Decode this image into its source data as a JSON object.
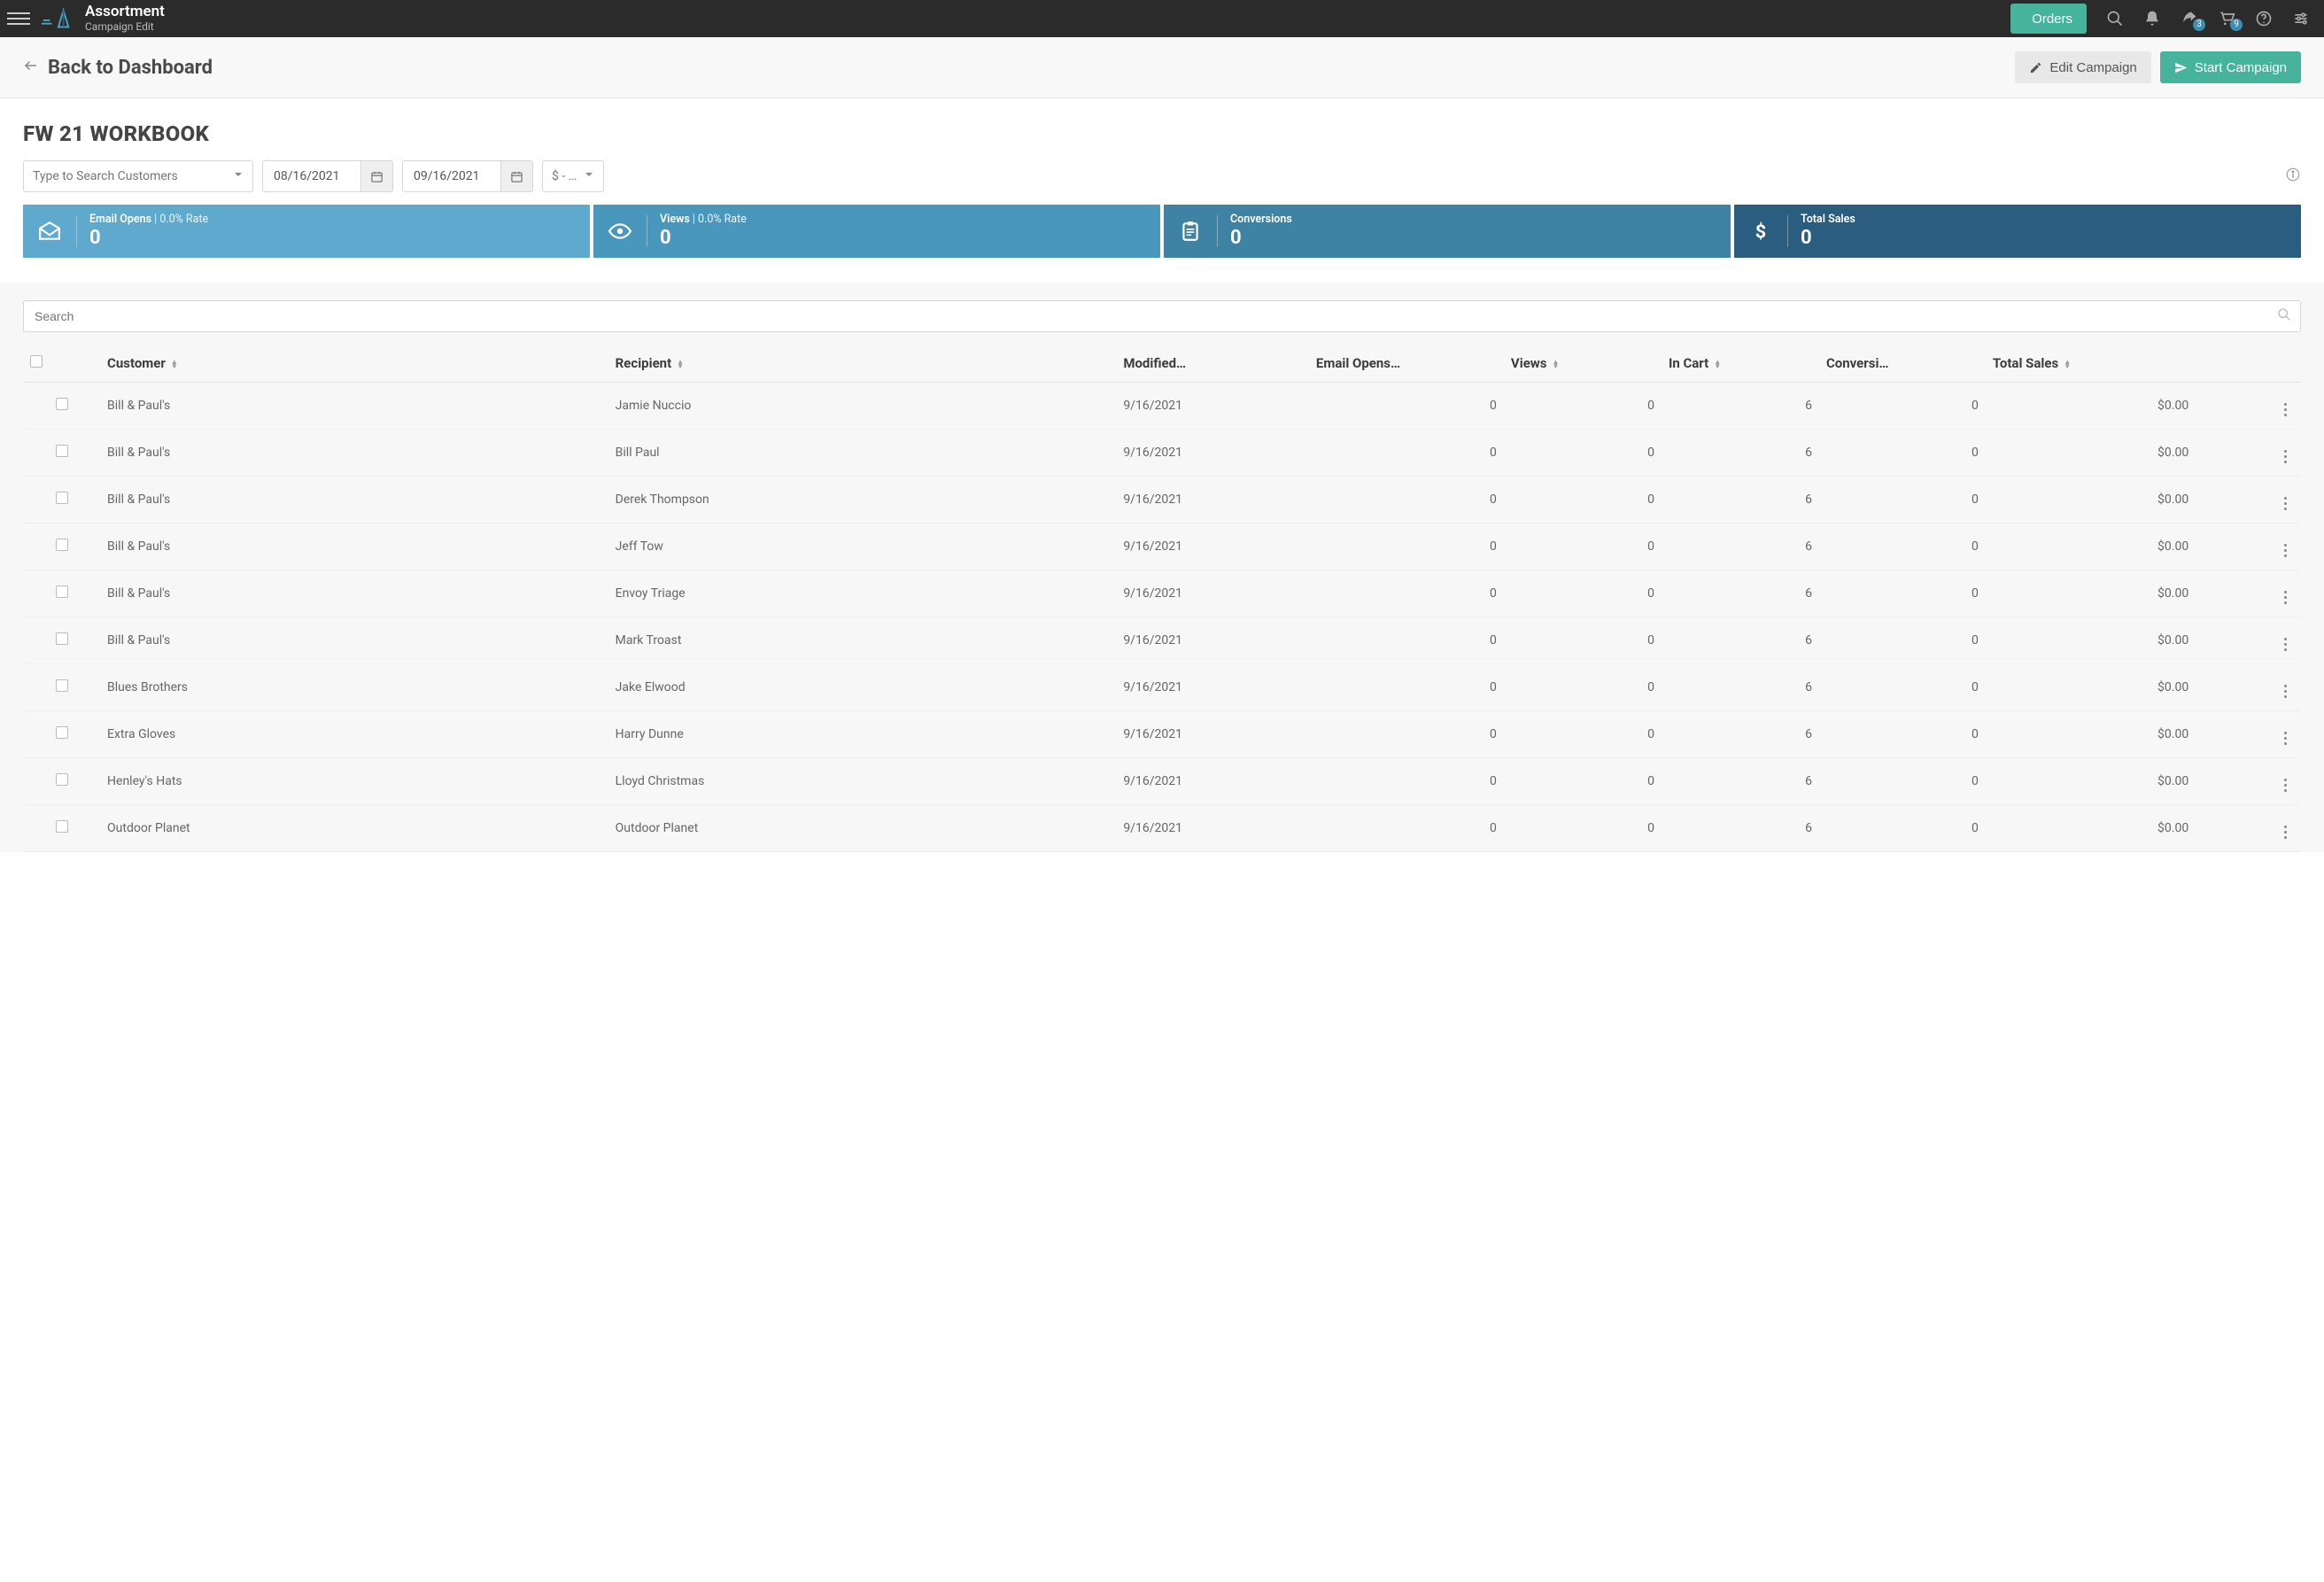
{
  "topbar": {
    "app_title": "Assortment",
    "app_subtitle": "Campaign Edit",
    "orders_label": "Orders",
    "share_badge": "3",
    "cart_badge": "9"
  },
  "subheader": {
    "back_label": "Back to Dashboard",
    "edit_label": "Edit Campaign",
    "start_label": "Start Campaign"
  },
  "page": {
    "title": "FW 21 WORKBOOK"
  },
  "filters": {
    "customer_placeholder": "Type to Search Customers",
    "date_start": "08/16/2021",
    "date_end": "09/16/2021",
    "currency_display": "$ - …"
  },
  "stats": {
    "email_opens": {
      "label": "Email Opens",
      "sub": " | 0.0% Rate",
      "value": "0"
    },
    "views": {
      "label": "Views",
      "sub": " | 0.0% Rate",
      "value": "0"
    },
    "conversions": {
      "label": "Conversions",
      "sub": "",
      "value": "0"
    },
    "total_sales": {
      "label": "Total Sales",
      "sub": "",
      "value": "0"
    }
  },
  "table": {
    "search_placeholder": "Search",
    "columns": {
      "customer": "Customer",
      "recipient": "Recipient",
      "modified": "Modified…",
      "email_opens": "Email Opens…",
      "views": "Views",
      "in_cart": "In Cart",
      "conversions": "Conversi…",
      "total_sales": "Total Sales"
    },
    "rows": [
      {
        "customer": "Bill & Paul's",
        "recipient": "Jamie Nuccio",
        "modified": "9/16/2021",
        "email_opens": "0",
        "views": "0",
        "in_cart": "6",
        "conversions": "0",
        "total_sales": "$0.00"
      },
      {
        "customer": "Bill & Paul's",
        "recipient": "Bill Paul",
        "modified": "9/16/2021",
        "email_opens": "0",
        "views": "0",
        "in_cart": "6",
        "conversions": "0",
        "total_sales": "$0.00"
      },
      {
        "customer": "Bill & Paul's",
        "recipient": "Derek Thompson",
        "modified": "9/16/2021",
        "email_opens": "0",
        "views": "0",
        "in_cart": "6",
        "conversions": "0",
        "total_sales": "$0.00"
      },
      {
        "customer": "Bill & Paul's",
        "recipient": "Jeff Tow",
        "modified": "9/16/2021",
        "email_opens": "0",
        "views": "0",
        "in_cart": "6",
        "conversions": "0",
        "total_sales": "$0.00"
      },
      {
        "customer": "Bill & Paul's",
        "recipient": "Envoy Triage",
        "modified": "9/16/2021",
        "email_opens": "0",
        "views": "0",
        "in_cart": "6",
        "conversions": "0",
        "total_sales": "$0.00"
      },
      {
        "customer": "Bill & Paul's",
        "recipient": "Mark Troast",
        "modified": "9/16/2021",
        "email_opens": "0",
        "views": "0",
        "in_cart": "6",
        "conversions": "0",
        "total_sales": "$0.00"
      },
      {
        "customer": "Blues Brothers",
        "recipient": "Jake Elwood",
        "modified": "9/16/2021",
        "email_opens": "0",
        "views": "0",
        "in_cart": "6",
        "conversions": "0",
        "total_sales": "$0.00"
      },
      {
        "customer": "Extra Gloves",
        "recipient": "Harry Dunne",
        "modified": "9/16/2021",
        "email_opens": "0",
        "views": "0",
        "in_cart": "6",
        "conversions": "0",
        "total_sales": "$0.00"
      },
      {
        "customer": "Henley's Hats",
        "recipient": "Lloyd Christmas",
        "modified": "9/16/2021",
        "email_opens": "0",
        "views": "0",
        "in_cart": "6",
        "conversions": "0",
        "total_sales": "$0.00"
      },
      {
        "customer": "Outdoor Planet",
        "recipient": "Outdoor Planet",
        "modified": "9/16/2021",
        "email_opens": "0",
        "views": "0",
        "in_cart": "6",
        "conversions": "0",
        "total_sales": "$0.00"
      }
    ]
  }
}
